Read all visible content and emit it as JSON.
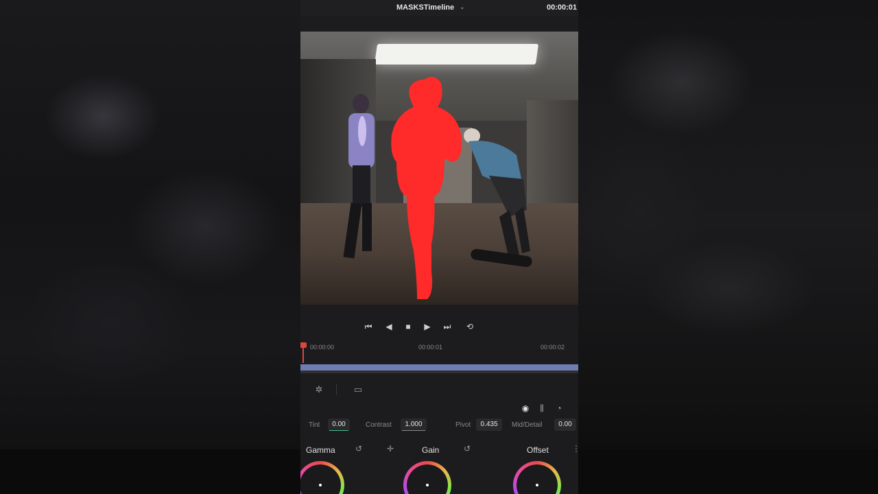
{
  "header": {
    "timeline_name": "MASKSTimeline",
    "timeline_chevron": "⌄",
    "timecode": "00:00:01"
  },
  "icons": {
    "skip_start": "⏮",
    "step_back": "◀",
    "stop": "■",
    "play": "▶",
    "skip_end": "⏭",
    "loop": "⟲",
    "magic_mask": "✲",
    "clip_view": "▭",
    "mode_primary": "◉",
    "mode_bars": "⫼",
    "mode_log": "◔",
    "reset": "↺",
    "picker": "✛",
    "more": "⋮"
  },
  "ruler": {
    "label_1": "00:00:00",
    "label_2": "00:00:01",
    "label_3": "00:00:02"
  },
  "params": {
    "tint_label": "Tint",
    "tint_value": "0.00",
    "contrast_label": "Contrast",
    "contrast_value": "1.000",
    "pivot_label": "Pivot",
    "pivot_value": "0.435",
    "middetail_label": "Mid/Detail",
    "middetail_value": "0.00"
  },
  "wheels": {
    "gamma": "Gamma",
    "gain": "Gain",
    "offset": "Offset"
  },
  "colors": {
    "mask_red": "#ff2a2a",
    "playhead": "#e0443e",
    "track": "#6f7db3"
  }
}
